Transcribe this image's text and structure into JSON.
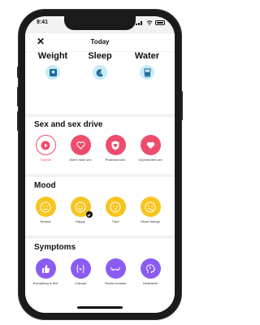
{
  "status": {
    "time": "9:41"
  },
  "header": {
    "title": "Today"
  },
  "quick_log": [
    {
      "label": "Weight",
      "icon": "scale-icon"
    },
    {
      "label": "Sleep",
      "icon": "sleep-icon"
    },
    {
      "label": "Water",
      "icon": "water-glass-icon"
    }
  ],
  "sex": {
    "title": "Sex and sex drive",
    "items": [
      {
        "label": "Tutorial",
        "icon": "play-icon",
        "selected": true
      },
      {
        "label": "Didn't have sex",
        "icon": "heart-outline-icon"
      },
      {
        "label": "Protected sex",
        "icon": "shield-heart-icon"
      },
      {
        "label": "Unprotected sex",
        "icon": "heart-icon"
      }
    ]
  },
  "mood": {
    "title": "Mood",
    "items": [
      {
        "label": "Normal",
        "icon": "neutral-face-icon"
      },
      {
        "label": "Happy",
        "icon": "happy-face-icon",
        "selected": true
      },
      {
        "label": "Tired",
        "icon": "tired-face-icon"
      },
      {
        "label": "Mood swings",
        "icon": "mood-swings-icon"
      }
    ]
  },
  "symptoms": {
    "title": "Symptoms",
    "items": [
      {
        "label": "Everything is fine",
        "icon": "thumb-up-icon"
      },
      {
        "label": "Cramps",
        "icon": "cramps-icon"
      },
      {
        "label": "Tender breasts",
        "icon": "tender-breasts-icon"
      },
      {
        "label": "Headache",
        "icon": "headache-icon"
      }
    ]
  },
  "colors": {
    "pink": "#ee4c6d",
    "yellow": "#f7c51e",
    "purple": "#8b5cf2",
    "blue_light": "#c8ecf6"
  }
}
